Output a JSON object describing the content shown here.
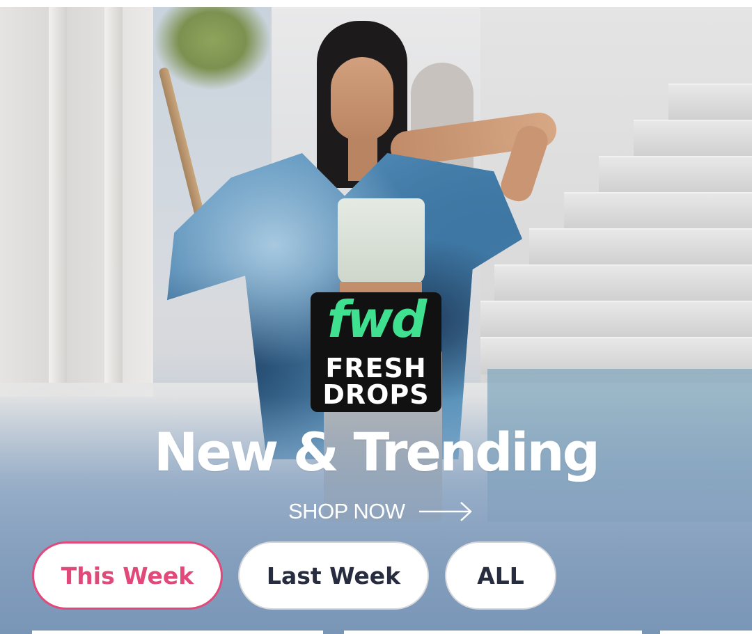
{
  "banner": {
    "logo": {
      "brand": "fwd",
      "line1": "FRESH",
      "line2": "DROPS"
    },
    "headline": "New & Trending",
    "cta_label": "SHOP NOW",
    "cta_icon": "arrow-right-icon"
  },
  "tabs": [
    {
      "label": "This Week",
      "active": true
    },
    {
      "label": "Last Week",
      "active": false
    },
    {
      "label": "ALL",
      "active": false
    }
  ],
  "colors": {
    "accent": "#e0497a",
    "logo_green": "#3fe08f",
    "tab_text": "#282c3f"
  }
}
